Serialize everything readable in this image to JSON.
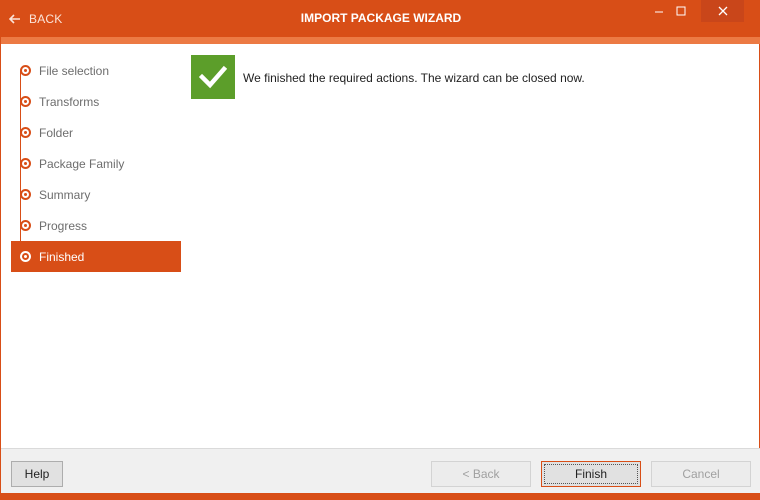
{
  "window": {
    "title": "IMPORT PACKAGE WIZARD",
    "back_label": "BACK",
    "accent_color": "#d84e17",
    "success_color": "#5c9e2a"
  },
  "steps": [
    {
      "label": "File selection",
      "active": false
    },
    {
      "label": "Transforms",
      "active": false
    },
    {
      "label": "Folder",
      "active": false
    },
    {
      "label": "Package Family",
      "active": false
    },
    {
      "label": "Summary",
      "active": false
    },
    {
      "label": "Progress",
      "active": false
    },
    {
      "label": "Finished",
      "active": true
    }
  ],
  "content": {
    "status_icon": "checkmark-icon",
    "message": "We finished the required actions. The wizard can be closed now."
  },
  "footer": {
    "help_label": "Help",
    "back_label": "< Back",
    "finish_label": "Finish",
    "cancel_label": "Cancel"
  }
}
